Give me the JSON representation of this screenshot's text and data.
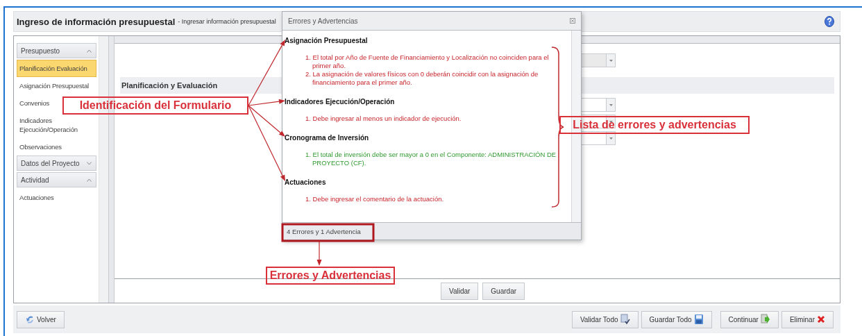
{
  "header": {
    "title": "Ingreso de información presupuestal",
    "subtitle": "- Ingresar información presupuestal"
  },
  "sidebar": {
    "groups": [
      {
        "label": "Presupuesto",
        "expanded": true,
        "items": [
          {
            "label": "Planificación Evaluación",
            "selected": true
          },
          {
            "label": "Asignación Presupuestal",
            "selected": false
          },
          {
            "label": "Convenios",
            "selected": false
          },
          {
            "label": "Indicadores Ejecución/Operación",
            "selected": false
          },
          {
            "label": "Observaciones",
            "selected": false
          }
        ]
      },
      {
        "label": "Datos del Proyecto",
        "expanded": false
      },
      {
        "label": "Actividad",
        "expanded": true,
        "items": [
          {
            "label": "Actuaciones",
            "selected": false
          }
        ]
      }
    ]
  },
  "main": {
    "section_title": "Planificación y Evaluación",
    "buttons": [
      "Validar",
      "Guardar"
    ]
  },
  "dialog": {
    "title": "Errores y Advertencias",
    "sections": [
      {
        "title": "Asignación Presupuestal",
        "messages": [
          {
            "text": "1. El total por Año de Fuente de Financiamiento y Localización no coinciden para el primer año.",
            "kind": "error"
          },
          {
            "text": "2. La asignación de valores físicos con 0 deberán coincidir con la asignación de financiamiento para el primer año.",
            "kind": "error"
          }
        ]
      },
      {
        "title": "Indicadores Ejecución/Operación",
        "messages": [
          {
            "text": "1. Debe ingresar al menos un indicador de ejecución.",
            "kind": "error"
          }
        ]
      },
      {
        "title": "Cronograma de Inversión",
        "messages": [
          {
            "text": "1. El total de inversión debe ser mayor a 0 en el Componente: ADMINISTRACIÓN DE PROYECTO (CF).",
            "kind": "warning"
          }
        ]
      },
      {
        "title": "Actuaciones",
        "messages": [
          {
            "text": "1. Debe ingresar el comentario de la actuación.",
            "kind": "error"
          }
        ]
      }
    ],
    "status": "4 Errores y 1 Advertencia"
  },
  "footer": {
    "back_button": "Volver",
    "buttons": [
      {
        "label": "Validar Todo",
        "kind": "validate"
      },
      {
        "label": "Guardar Todo",
        "kind": "save"
      },
      {
        "label": "Continuar",
        "kind": "continue"
      },
      {
        "label": "Eliminar",
        "kind": "delete"
      }
    ]
  },
  "annotations": [
    {
      "text": "Identificación del Formulario"
    },
    {
      "text": "Lista de errores y advertencias"
    },
    {
      "text": "Errores y Advertencias"
    }
  ]
}
